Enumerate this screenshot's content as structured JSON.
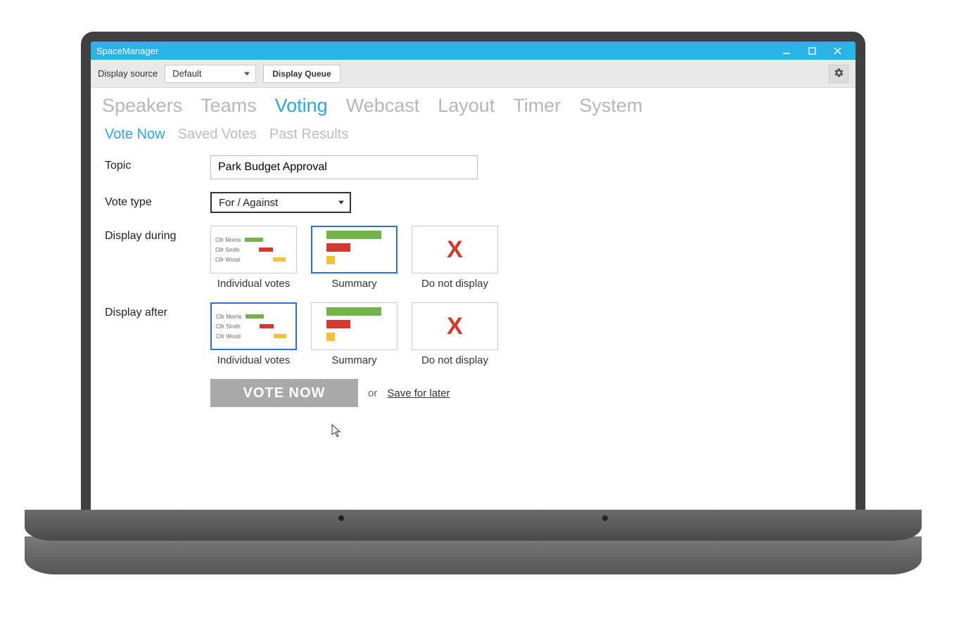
{
  "window": {
    "title": "SpaceManager"
  },
  "toolbar": {
    "source_label": "Display source",
    "source_value": "Default",
    "display_queue_label": "Display Queue"
  },
  "tabs_primary": [
    "Speakers",
    "Teams",
    "Voting",
    "Webcast",
    "Layout",
    "Timer",
    "System"
  ],
  "tabs_primary_active": 2,
  "tabs_secondary": [
    "Vote Now",
    "Saved Votes",
    "Past Results"
  ],
  "tabs_secondary_active": 0,
  "form": {
    "topic_label": "Topic",
    "topic_value": "Park Budget Approval",
    "vote_type_label": "Vote type",
    "vote_type_value": "For / Against",
    "display_during_label": "Display during",
    "display_after_label": "Display after",
    "option_individual": "Individual votes",
    "option_summary": "Summary",
    "option_none": "Do not display",
    "during_selected": "summary",
    "after_selected": "individual",
    "sample_names": [
      "Cllr Morris",
      "Cllr Smith",
      "Cllr Wood"
    ]
  },
  "actions": {
    "vote_now": "VOTE NOW",
    "or": "or",
    "save_later": "Save for later"
  }
}
